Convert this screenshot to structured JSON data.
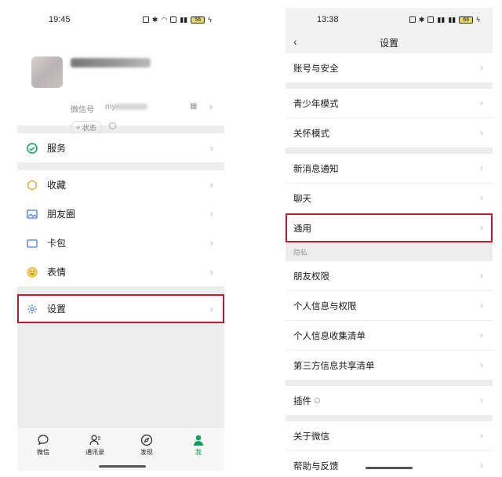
{
  "left": {
    "status_time": "19:45",
    "battery": "56",
    "profile": {
      "nickname": "",
      "wechat_id_label": "微信号",
      "wechat_id_value": "my",
      "status_button": "+ 状态"
    },
    "menu": [
      {
        "label": "服务",
        "icon": "wallet-icon"
      },
      {
        "label": "收藏",
        "icon": "cube-icon"
      },
      {
        "label": "朋友圈",
        "icon": "image-icon"
      },
      {
        "label": "卡包",
        "icon": "card-icon"
      },
      {
        "label": "表情",
        "icon": "smile-icon"
      },
      {
        "label": "设置",
        "icon": "gear-icon"
      }
    ],
    "tabs": [
      {
        "label": "微信",
        "icon": "chat-icon"
      },
      {
        "label": "通讯录",
        "icon": "contacts-icon"
      },
      {
        "label": "发现",
        "icon": "compass-icon"
      },
      {
        "label": "我",
        "icon": "person-icon"
      }
    ]
  },
  "right": {
    "status_time": "13:38",
    "battery": "66",
    "title": "设置",
    "rows": {
      "account_security": "账号与安全",
      "teen_mode": "青少年模式",
      "care_mode": "关怀模式",
      "new_message_notify": "新消息通知",
      "chat": "聊天",
      "general": "通用",
      "privacy_section": "隐私",
      "friend_permissions": "朋友权限",
      "personal_info_permissions": "个人信息与权限",
      "personal_info_collection": "个人信息收集清单",
      "third_party_sharing": "第三方信息共享清单",
      "plugins": "插件",
      "about_wechat": "关于微信",
      "help_feedback": "帮助与反馈"
    }
  },
  "colors": {
    "accent_green": "#07a35a",
    "highlight_red": "#b3202e"
  }
}
